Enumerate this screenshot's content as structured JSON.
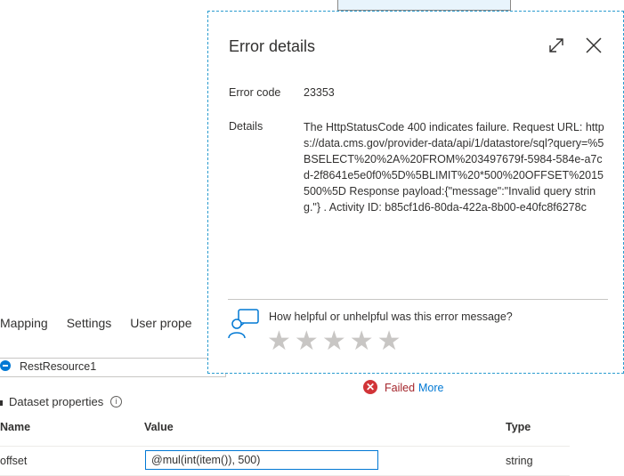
{
  "tabs": [
    "Mapping",
    "Settings",
    "User prope"
  ],
  "resource": {
    "label": "RestResource1"
  },
  "status": {
    "failed_label": "Failed",
    "more_label": "More",
    "color": "#d13438"
  },
  "dataset": {
    "title": "Dataset properties",
    "columns": {
      "name": "Name",
      "value": "Value",
      "type": "Type"
    },
    "row": {
      "name": "offset",
      "value": "@mul(int(item()), 500)",
      "type": "string"
    }
  },
  "error_panel": {
    "title": "Error details",
    "error_code_label": "Error code",
    "error_code": "23353",
    "details_label": "Details",
    "details": "The HttpStatusCode 400 indicates failure. Request URL: https://data.cms.gov/provider-data/api/1/datastore/sql?query=%5BSELECT%20%2A%20FROM%203497679f-5984-584e-a7cd-2f8641e5e0f0%5D%5BLIMIT%20*500%20OFFSET%2015500%5D Response payload:{\"message\":\"Invalid query string.\"} . Activity ID: b85cf1d6-80da-422a-8b00-e40fc8f6278c",
    "feedback_question": "How helpful or unhelpful was this error message?",
    "star_count": 5,
    "accent_color": "#2b9ccf"
  },
  "icons": {
    "expand": "expand-icon",
    "close": "close-icon",
    "feedback": "feedback-person-icon",
    "star": "star-icon",
    "error": "error-circle-icon",
    "info": "info-icon"
  }
}
